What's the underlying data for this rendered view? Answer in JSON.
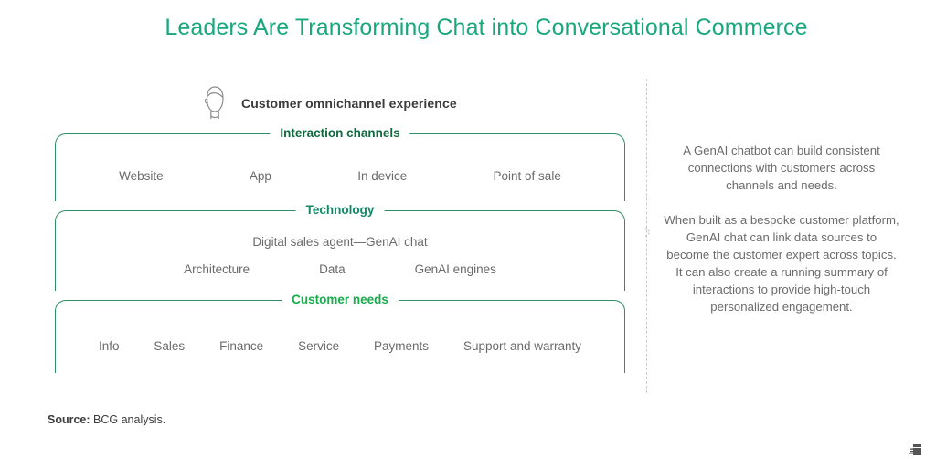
{
  "title": "Leaders Are Transforming Chat into Conversational Commerce",
  "colors": {
    "title_green": "#1aa77e",
    "interaction_green": "#12693f",
    "technology_green": "#0f8a64",
    "needs_green": "#17ad4b",
    "border_green": "#2f8f62",
    "body_gray": "#6b6b6b",
    "dark_gray": "#3c3c3c",
    "divider_gray": "#c9c9c9"
  },
  "omnichannel": {
    "icon": "person-head-icon",
    "label": "Customer omnichannel experience"
  },
  "groups": [
    {
      "id": "interaction-channels",
      "label": "Interaction channels",
      "label_color": "#12693f",
      "items": [
        "Website",
        "App",
        "In device",
        "Point of sale"
      ]
    },
    {
      "id": "technology",
      "label": "Technology",
      "label_color": "#0f8a64",
      "main_item": "Digital sales agent—GenAI chat",
      "items": [
        "Architecture",
        "Data",
        "GenAI engines"
      ]
    },
    {
      "id": "customer-needs",
      "label": "Customer needs",
      "label_color": "#17ad4b",
      "items": [
        "Info",
        "Sales",
        "Finance",
        "Service",
        "Payments",
        "Support and warranty"
      ]
    }
  ],
  "commentary": {
    "paragraph_1": "A GenAI chatbot can build consistent connections with customers across channels and needs.",
    "paragraph_2": "When built as a bespoke customer platform, GenAI chat can link data sources to become the customer expert across topics. It can also create a running summary of interactions to provide high-touch personalized engagement."
  },
  "footer": {
    "source_label": "Source:",
    "source_value": "BCG analysis."
  }
}
